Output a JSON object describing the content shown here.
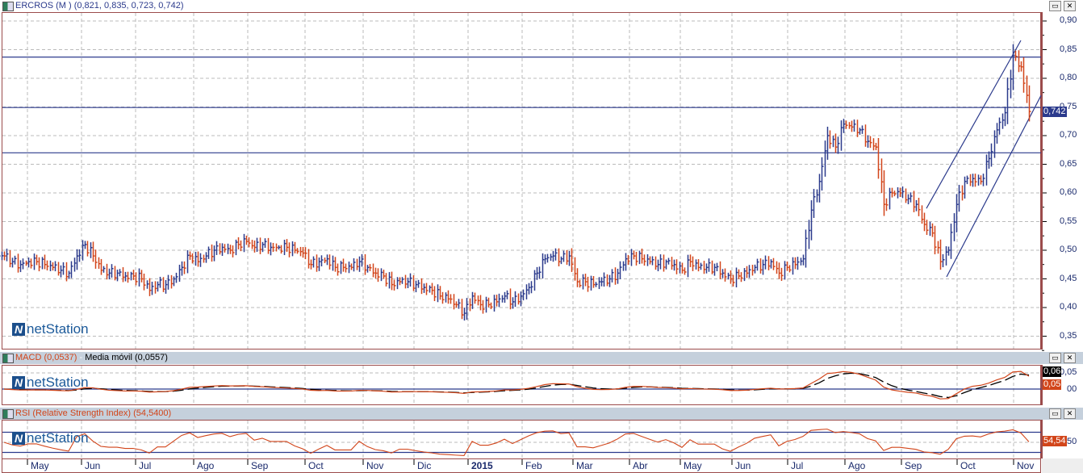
{
  "main_header": {
    "title": "ERCROS (M ) (0,821, 0,835, 0,723, 0,742)"
  },
  "macd_header": {
    "macd": "MACD (0,0537)",
    "sep": " - ",
    "signal": "Media móvil (0,0557)"
  },
  "rsi_header": {
    "title": "RSI (Relative Strength Index) (54,5400)"
  },
  "window_buttons": {
    "restore": "▭",
    "close": "✕"
  },
  "logo": {
    "text": "netStation"
  },
  "price_axis": {
    "labels": [
      "0,90",
      "0,85",
      "0,80",
      "0,75",
      "0,70",
      "0,65",
      "0,60",
      "0,55",
      "0,50",
      "0,45",
      "0,40",
      "0,35"
    ],
    "current": "0,742"
  },
  "macd_axis": {
    "labels": [
      "0,05",
      "00"
    ],
    "macd_value": "0,06",
    "signal_value": "0,05"
  },
  "rsi_axis": {
    "labels": [
      "50"
    ],
    "value": "54,54"
  },
  "colors": {
    "up": "#2b3a8c",
    "down": "#d2451a",
    "frame": "#9b4b4b",
    "header_bg": "#c5d0dc",
    "line": "#2b3a8c"
  },
  "chart_data": {
    "type": "ohlc",
    "title": "ERCROS (M )",
    "ylim": [
      0.33,
      0.915
    ],
    "y_ticks": [
      0.9,
      0.85,
      0.8,
      0.75,
      0.7,
      0.65,
      0.6,
      0.55,
      0.5,
      0.45,
      0.4,
      0.35
    ],
    "x_labels": [
      {
        "label": "May",
        "i": 2.9
      },
      {
        "label": "Jun",
        "i": 9.6
      },
      {
        "label": "Jul",
        "i": 16.3
      },
      {
        "label": "Ago",
        "i": 23.5
      },
      {
        "label": "Sep",
        "i": 30.2
      },
      {
        "label": "Oct",
        "i": 37.3
      },
      {
        "label": "Nov",
        "i": 44.5
      },
      {
        "label": "Dic",
        "i": 50.8
      },
      {
        "label": "2015",
        "i": 57.5,
        "bold": true
      },
      {
        "label": "Feb",
        "i": 64.2
      },
      {
        "label": "Mar",
        "i": 70.5
      },
      {
        "label": "Abr",
        "i": 77.5
      },
      {
        "label": "May",
        "i": 83.8
      },
      {
        "label": "Jun",
        "i": 90.2
      },
      {
        "label": "Jul",
        "i": 97.1
      },
      {
        "label": "Ago",
        "i": 104.2
      },
      {
        "label": "Sep",
        "i": 111.2
      },
      {
        "label": "Oct",
        "i": 118.1
      },
      {
        "label": "Nov",
        "i": 125.1
      }
    ],
    "closes": [
      0.49,
      0.48,
      0.475,
      0.48,
      0.48,
      0.475,
      0.47,
      0.465,
      0.46,
      0.49,
      0.51,
      0.49,
      0.465,
      0.46,
      0.46,
      0.455,
      0.455,
      0.45,
      0.43,
      0.44,
      0.44,
      0.45,
      0.47,
      0.49,
      0.48,
      0.49,
      0.5,
      0.505,
      0.5,
      0.51,
      0.515,
      0.505,
      0.51,
      0.505,
      0.505,
      0.505,
      0.5,
      0.495,
      0.475,
      0.48,
      0.485,
      0.47,
      0.47,
      0.47,
      0.48,
      0.47,
      0.46,
      0.455,
      0.44,
      0.445,
      0.445,
      0.44,
      0.435,
      0.43,
      0.42,
      0.415,
      0.405,
      0.39,
      0.42,
      0.405,
      0.405,
      0.41,
      0.42,
      0.41,
      0.42,
      0.435,
      0.46,
      0.485,
      0.49,
      0.485,
      0.49,
      0.445,
      0.445,
      0.44,
      0.445,
      0.45,
      0.46,
      0.485,
      0.49,
      0.485,
      0.48,
      0.475,
      0.48,
      0.475,
      0.465,
      0.48,
      0.47,
      0.47,
      0.47,
      0.46,
      0.45,
      0.455,
      0.46,
      0.47,
      0.475,
      0.48,
      0.46,
      0.47,
      0.475,
      0.485,
      0.57,
      0.62,
      0.7,
      0.68,
      0.72,
      0.715,
      0.71,
      0.69,
      0.68,
      0.58,
      0.6,
      0.6,
      0.59,
      0.58,
      0.545,
      0.53,
      0.48,
      0.5,
      0.58,
      0.62,
      0.625,
      0.62,
      0.66,
      0.71,
      0.74,
      0.84,
      0.82,
      0.742
    ],
    "horizontal_lines": [
      0.837,
      0.749,
      0.67
    ],
    "channel_lines": [
      {
        "from": {
          "i": 114.3,
          "v": 0.573
        },
        "to": {
          "i": 126.0,
          "v": 0.866
        }
      },
      {
        "from": {
          "i": 116.8,
          "v": 0.4535
        },
        "to": {
          "i": 128.5,
          "v": 0.77
        }
      }
    ],
    "macd": {
      "zero_line": 0,
      "ylim": [
        -0.045,
        0.075
      ],
      "ticks": [
        0.05,
        0
      ]
    },
    "rsi": {
      "ylim": [
        0,
        100
      ],
      "bands": [
        70,
        30
      ],
      "mid": 50
    }
  }
}
